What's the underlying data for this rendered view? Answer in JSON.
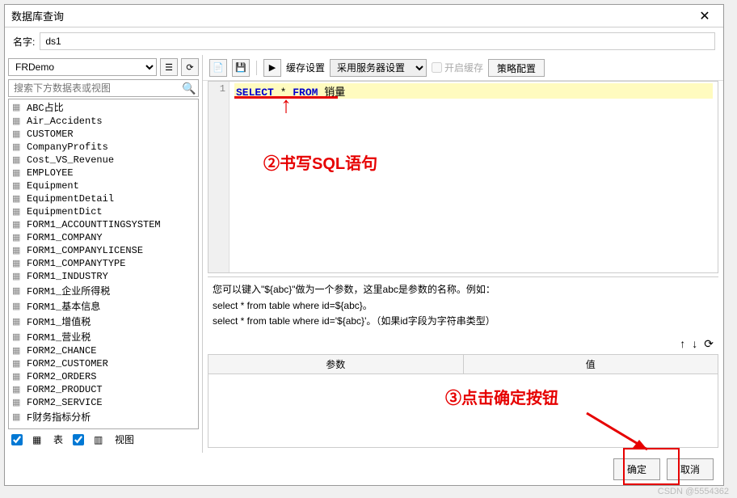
{
  "dialog": {
    "title": "数据库查询",
    "close": "✕"
  },
  "nameRow": {
    "label": "名字:",
    "value": "ds1"
  },
  "dbSelect": {
    "value": "FRDemo"
  },
  "search": {
    "placeholder": "搜索下方数据表或视图"
  },
  "tables": [
    "ABC占比",
    "Air_Accidents",
    "CUSTOMER",
    "CompanyProfits",
    "Cost_VS_Revenue",
    "EMPLOYEE",
    "Equipment",
    "EquipmentDetail",
    "EquipmentDict",
    "FORM1_ACCOUNTTINGSYSTEM",
    "FORM1_COMPANY",
    "FORM1_COMPANYLICENSE",
    "FORM1_COMPANYTYPE",
    "FORM1_INDUSTRY",
    "FORM1_企业所得税",
    "FORM1_基本信息",
    "FORM1_增值税",
    "FORM1_营业税",
    "FORM2_CHANCE",
    "FORM2_CUSTOMER",
    "FORM2_ORDERS",
    "FORM2_PRODUCT",
    "FORM2_SERVICE",
    "F财务指标分析"
  ],
  "filters": {
    "tableLabel": "表",
    "viewLabel": "视图"
  },
  "toolbar": {
    "cacheLabel": "缓存设置",
    "cacheValue": "采用服务器设置",
    "enableCache": "开启缓存",
    "strategy": "策略配置"
  },
  "sql": {
    "lineNo": "1",
    "kw1": "SELECT",
    "star": "*",
    "kw2": "FROM",
    "table": "销量"
  },
  "hint": {
    "l1": "您可以键入\"${abc}\"做为一个参数，这里abc是参数的名称。例如：",
    "l2": "select * from table where id=${abc}。",
    "l3": "select * from table where id='${abc}'。（如果id字段为字符串类型）"
  },
  "arrows": {
    "up": "↑",
    "down": "↓",
    "refresh": "⟳"
  },
  "paramTable": {
    "col1": "参数",
    "col2": "值"
  },
  "buttons": {
    "ok": "确定",
    "cancel": "取消"
  },
  "annotations": {
    "t1": "②书写SQL语句",
    "t2": "③点击确定按钮"
  },
  "watermark": "CSDN @5554362"
}
